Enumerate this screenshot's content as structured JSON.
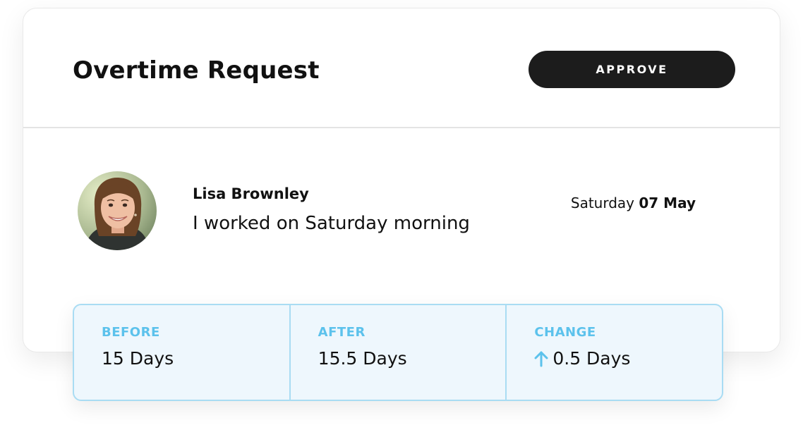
{
  "header": {
    "title": "Overtime Request",
    "approve_label": "APPROVE"
  },
  "request": {
    "name": "Lisa Brownley",
    "message": "I worked on Saturday morning",
    "day": "Saturday",
    "date": "07 May"
  },
  "stats": [
    {
      "label": "BEFORE",
      "value": "15 Days"
    },
    {
      "label": "AFTER",
      "value": "15.5 Days"
    },
    {
      "label": "CHANGE",
      "value": "0.5 Days",
      "icon": "arrow-up-icon"
    }
  ],
  "colors": {
    "accent": "#5cc2ec",
    "stats_bg": "#eef7fd",
    "stats_border": "#a9dcf3",
    "button_bg": "#1c1c1c"
  }
}
